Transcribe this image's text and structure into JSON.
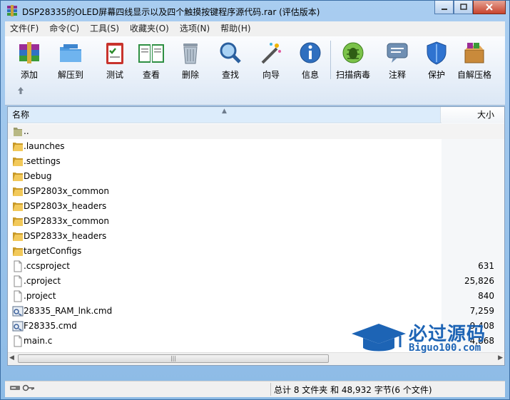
{
  "window": {
    "title": "DSP28335的OLED屏幕四线显示以及四个触摸按键程序源代码.rar (评估版本)"
  },
  "menu": [
    "文件(F)",
    "命令(C)",
    "工具(S)",
    "收藏夹(O)",
    "选项(N)",
    "帮助(H)"
  ],
  "toolbar": {
    "add": "添加",
    "extract": "解压到",
    "test": "测试",
    "view": "查看",
    "delete": "删除",
    "find": "查找",
    "wizard": "向导",
    "info": "信息",
    "scan": "扫描病毒",
    "comment": "注释",
    "protect": "保护",
    "sfx": "自解压格"
  },
  "columns": {
    "name": "名称",
    "size": "大小"
  },
  "files": [
    {
      "name": "..",
      "size": "",
      "type": "up"
    },
    {
      "name": ".launches",
      "size": "",
      "type": "folder"
    },
    {
      "name": ".settings",
      "size": "",
      "type": "folder"
    },
    {
      "name": "Debug",
      "size": "",
      "type": "folder"
    },
    {
      "name": "DSP2803x_common",
      "size": "",
      "type": "folder"
    },
    {
      "name": "DSP2803x_headers",
      "size": "",
      "type": "folder"
    },
    {
      "name": "DSP2833x_common",
      "size": "",
      "type": "folder"
    },
    {
      "name": "DSP2833x_headers",
      "size": "",
      "type": "folder"
    },
    {
      "name": "targetConfigs",
      "size": "",
      "type": "folder"
    },
    {
      "name": ".ccsproject",
      "size": "631",
      "type": "file"
    },
    {
      "name": ".cproject",
      "size": "25,826",
      "type": "file"
    },
    {
      "name": ".project",
      "size": "840",
      "type": "file"
    },
    {
      "name": "28335_RAM_lnk.cmd",
      "size": "7,259",
      "type": "cmd"
    },
    {
      "name": "F28335.cmd",
      "size": "9,408",
      "type": "cmd"
    },
    {
      "name": "main.c",
      "size": "4,868",
      "type": "file"
    }
  ],
  "status": {
    "summary": "总计 8 文件夹 和 48,932 字节(6 个文件)"
  },
  "watermark": {
    "cn": "必过源码",
    "url": "Biguo100.com"
  },
  "colors": {
    "accent": "#1d64b5",
    "folder": "#e8b93c"
  }
}
